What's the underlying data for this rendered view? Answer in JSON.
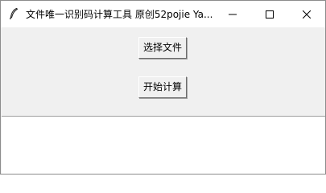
{
  "window": {
    "title": "文件唯一识别码计算工具 原创52pojie Ya...",
    "icon": "feather-icon",
    "controls": {
      "minimize_icon": "minimize-icon",
      "maximize_icon": "maximize-icon",
      "close_icon": "close-icon"
    }
  },
  "buttons": {
    "select_file_label": "选择文件",
    "start_calc_label": "开始计算"
  },
  "output": {
    "value": ""
  },
  "colors": {
    "window_bg": "#f0f0f0",
    "titlebar_bg": "#ffffff",
    "output_bg": "#ffffff"
  }
}
